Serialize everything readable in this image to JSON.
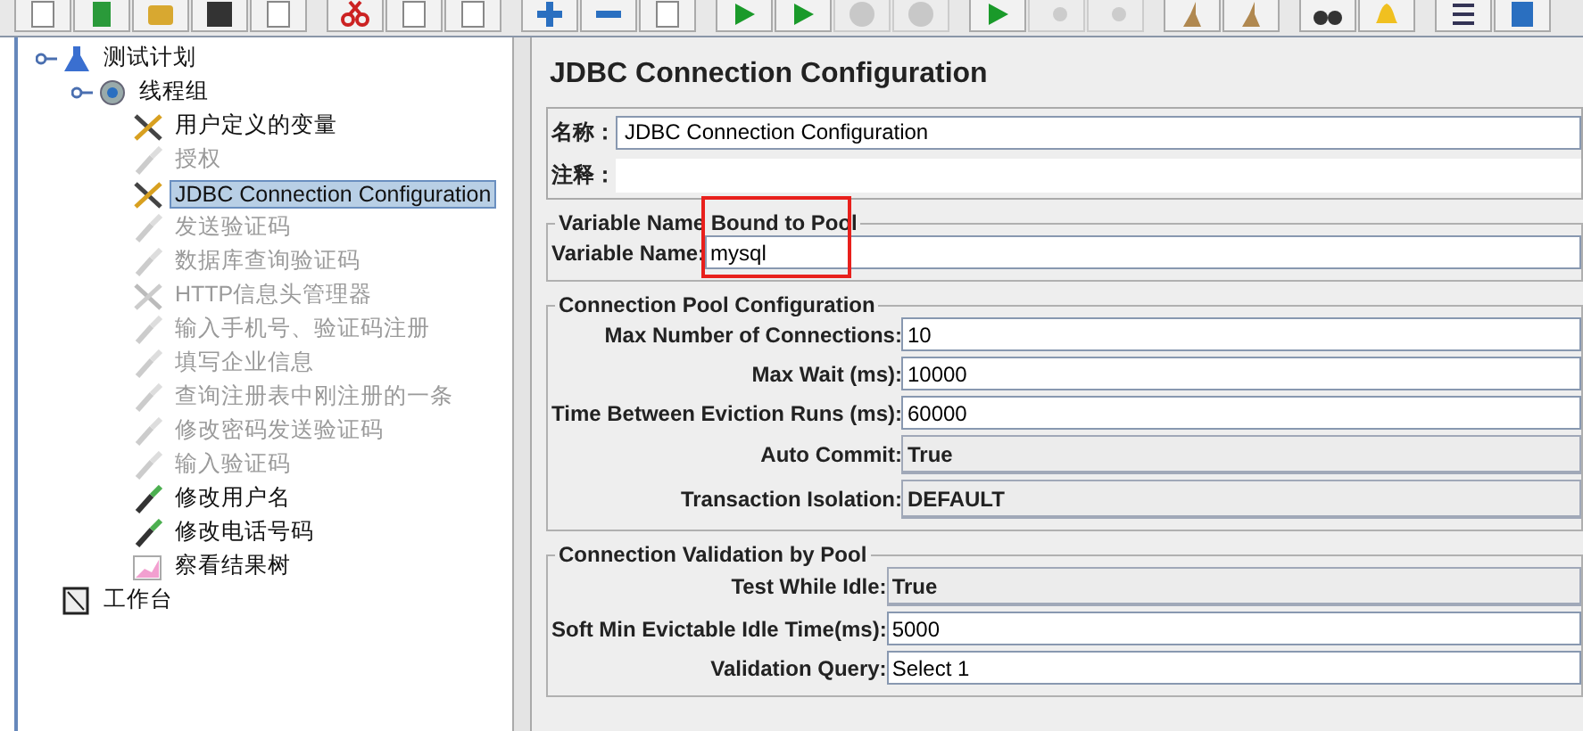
{
  "toolbar": [
    {
      "buttons": [
        {
          "disabled": false
        },
        {
          "disabled": false
        },
        {
          "disabled": false
        },
        {
          "disabled": false
        },
        {
          "disabled": false
        }
      ]
    },
    {
      "buttons": [
        {
          "disabled": false
        },
        {
          "disabled": false
        },
        {
          "disabled": false
        }
      ]
    },
    {
      "buttons": [
        {
          "disabled": false
        },
        {
          "disabled": false
        },
        {
          "disabled": false
        }
      ]
    },
    {
      "buttons": [
        {
          "disabled": false
        },
        {
          "disabled": false
        },
        {
          "disabled": true
        },
        {
          "disabled": true
        }
      ]
    },
    {
      "buttons": [
        {
          "disabled": false
        },
        {
          "disabled": true
        },
        {
          "disabled": true
        }
      ]
    },
    {
      "buttons": [
        {
          "disabled": false
        },
        {
          "disabled": false
        }
      ]
    },
    {
      "buttons": [
        {
          "disabled": false
        },
        {
          "disabled": false
        }
      ]
    },
    {
      "buttons": [
        {
          "disabled": false
        },
        {
          "disabled": false
        }
      ]
    }
  ],
  "tree": [
    {
      "label": "测试计划",
      "kind": "plan",
      "disabled": false,
      "selected": false,
      "children": [
        {
          "label": "线程组",
          "kind": "threads",
          "disabled": false,
          "selected": false,
          "children": [
            {
              "label": "用户定义的变量",
              "kind": "config",
              "disabled": false,
              "selected": false
            },
            {
              "label": "授权",
              "kind": "sampler",
              "disabled": true,
              "selected": false
            },
            {
              "label": "JDBC Connection Configuration",
              "kind": "config",
              "disabled": false,
              "selected": true
            },
            {
              "label": "发送验证码",
              "kind": "sampler",
              "disabled": true,
              "selected": false
            },
            {
              "label": "数据库查询验证码",
              "kind": "sampler",
              "disabled": true,
              "selected": false
            },
            {
              "label": "HTTP信息头管理器",
              "kind": "config",
              "disabled": true,
              "selected": false
            },
            {
              "label": "输入手机号、验证码注册",
              "kind": "sampler",
              "disabled": true,
              "selected": false
            },
            {
              "label": "填写企业信息",
              "kind": "sampler",
              "disabled": true,
              "selected": false
            },
            {
              "label": "查询注册表中刚注册的一条",
              "kind": "sampler",
              "disabled": true,
              "selected": false
            },
            {
              "label": "修改密码发送验证码",
              "kind": "sampler",
              "disabled": true,
              "selected": false
            },
            {
              "label": "输入验证码",
              "kind": "sampler",
              "disabled": true,
              "selected": false
            },
            {
              "label": "修改用户名",
              "kind": "sampler",
              "disabled": false,
              "selected": false
            },
            {
              "label": "修改电话号码",
              "kind": "sampler",
              "disabled": false,
              "selected": false
            },
            {
              "label": "察看结果树",
              "kind": "listener",
              "disabled": false,
              "selected": false
            }
          ]
        }
      ]
    },
    {
      "label": "工作台",
      "kind": "workbench",
      "disabled": false,
      "selected": false
    }
  ],
  "panel": {
    "title": "JDBC Connection Configuration",
    "name_label": "名称：",
    "name_value": "JDBC Connection Configuration",
    "comment_label": "注释：",
    "groups": [
      {
        "title": "Variable Name Bound to Pool",
        "highlighted": true,
        "fields": [
          {
            "label": "Variable Name:",
            "value": "mysql",
            "kind": "text"
          }
        ]
      },
      {
        "title": "Connection Pool Configuration",
        "fields": [
          {
            "label": "Max Number of Connections:",
            "value": "10",
            "kind": "text"
          },
          {
            "label": "Max Wait (ms):",
            "value": "10000",
            "kind": "text"
          },
          {
            "label": "Time Between Eviction Runs (ms):",
            "value": "60000",
            "kind": "text"
          },
          {
            "label": "Auto Commit:",
            "value": "True",
            "kind": "combo"
          },
          {
            "label": "Transaction Isolation:",
            "value": "DEFAULT",
            "kind": "combo"
          }
        ]
      },
      {
        "title": "Connection Validation by Pool",
        "fields": [
          {
            "label": "Test While Idle:",
            "value": "True",
            "kind": "combo"
          },
          {
            "label": "Soft Min Evictable Idle Time(ms):",
            "value": "5000",
            "kind": "text"
          },
          {
            "label": "Validation Query:",
            "value": "Select 1",
            "kind": "text"
          }
        ]
      }
    ]
  }
}
